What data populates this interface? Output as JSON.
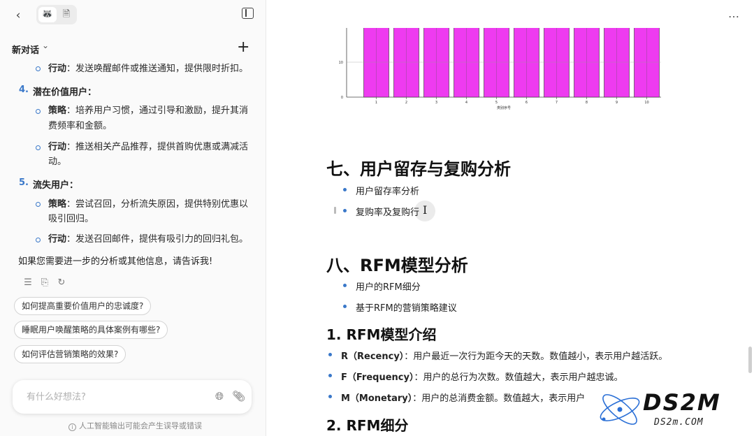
{
  "sidebar": {
    "toolbar": {
      "back_icon": "chevron-left-icon",
      "seg_a_icon": "raccoon-avatar-icon",
      "seg_b_icon": "document-icon",
      "toggle_icon": "sidebar-icon"
    },
    "conversation_title": "新对话",
    "message": {
      "block_top_action": {
        "label": "行动",
        "text": "：发送唤醒邮件或推送通知，提供限时折扣。"
      },
      "item4": {
        "number": "4.",
        "title": "潜在价值用户：",
        "strategy": {
          "label": "策略",
          "text_line1": "：培养用户习惯，通过引导和激励，提升其消",
          "text_line2": "费频率和金额。"
        },
        "action": {
          "label": "行动",
          "text_line1": "：推送相关产品推荐，提供首购优惠或满减活",
          "text_line2": "动。"
        }
      },
      "item5": {
        "number": "5.",
        "title": "流失用户：",
        "strategy": {
          "label": "策略",
          "text_line1": "：尝试召回，分析流失原因，提供特别优惠以",
          "text_line2": "吸引回归。"
        },
        "action": {
          "label": "行动",
          "text_line1": "：发送召回邮件，提供有吸引力的回归礼包。"
        }
      },
      "closing": "如果您需要进一步的分析或其他信息，请告诉我!"
    },
    "suggestions": [
      "如何提高重要价值用户的忠诚度?",
      "睡眠用户唤醒策略的具体案例有哪些?",
      "如何评估营销策略的效果?"
    ],
    "input": {
      "placeholder": "有什么好想法?"
    },
    "disclaimer": "人工智能输出可能会产生误导或错误"
  },
  "document": {
    "section7": {
      "title": "七、用户留存与复购分析",
      "bullets": [
        "用户留存率分析",
        "复购率及复购行"
      ]
    },
    "section8": {
      "title": "八、RFM模型分析",
      "bullets": [
        "用户的RFM细分",
        "基于RFM的营销策略建议"
      ]
    },
    "sub1": {
      "title": "1. RFM模型介绍",
      "items": [
        {
          "term": "R（Recency）",
          "text": "：用户最近一次行为距今天的天数。数值越小，表示用户越活跃。"
        },
        {
          "term": "F（Frequency）",
          "text": "：用户的总行为次数。数值越大，表示用户越忠诚。"
        },
        {
          "term": "M（Monetary）",
          "text": "：用户的总消费金额。数值越大，表示用户"
        }
      ]
    },
    "sub2": {
      "title": "2. RFM细分"
    }
  },
  "watermark": {
    "main": "DS2M",
    "sub": "DS2m.COM"
  },
  "chart_data": {
    "type": "bar",
    "categories": [
      "1",
      "2",
      "3",
      "4",
      "5",
      "6",
      "7",
      "8",
      "9",
      "10"
    ],
    "values": [
      20,
      20,
      20,
      20,
      20,
      20,
      20,
      20,
      20,
      20
    ],
    "xlabel": "类别序号",
    "ylabel": "",
    "yticks": [
      "0",
      "10"
    ],
    "ylim": [
      0,
      20
    ],
    "bar_color": "#ee3bf0",
    "grid": true
  }
}
